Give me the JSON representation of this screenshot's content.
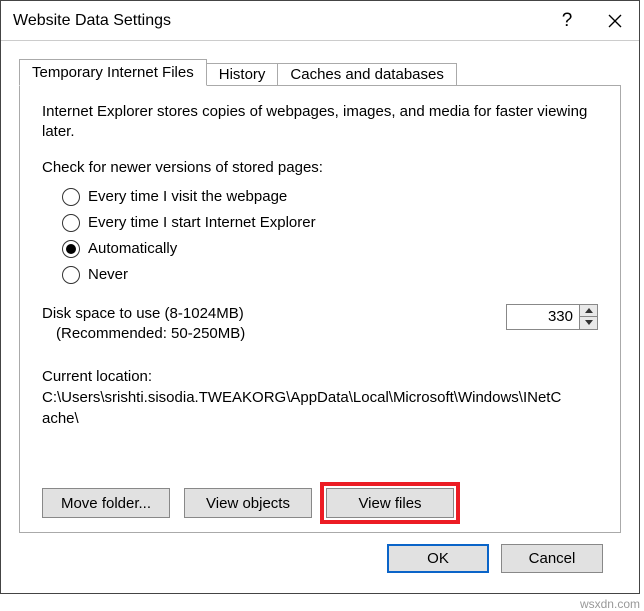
{
  "titlebar": {
    "title": "Website Data Settings",
    "help": "?",
    "close": "✕"
  },
  "tabs": {
    "t0": "Temporary Internet Files",
    "t1": "History",
    "t2": "Caches and databases"
  },
  "panel": {
    "description": "Internet Explorer stores copies of webpages, images, and media for faster viewing later.",
    "check_label": "Check for newer versions of stored pages:",
    "radios": {
      "r0": "Every time I visit the webpage",
      "r1": "Every time I start Internet Explorer",
      "r2": "Automatically",
      "r3": "Never"
    },
    "disk_label": "Disk space to use (8-1024MB)",
    "disk_recommended": "(Recommended: 50-250MB)",
    "disk_value": "330",
    "location_label": "Current location:",
    "location_path": "C:\\Users\\srishti.sisodia.TWEAKORG\\AppData\\Local\\Microsoft\\Windows\\INetCache\\",
    "buttons": {
      "move": "Move folder...",
      "view_objects": "View objects",
      "view_files": "View files"
    }
  },
  "footer": {
    "ok": "OK",
    "cancel": "Cancel"
  },
  "watermark": "wsxdn.com"
}
